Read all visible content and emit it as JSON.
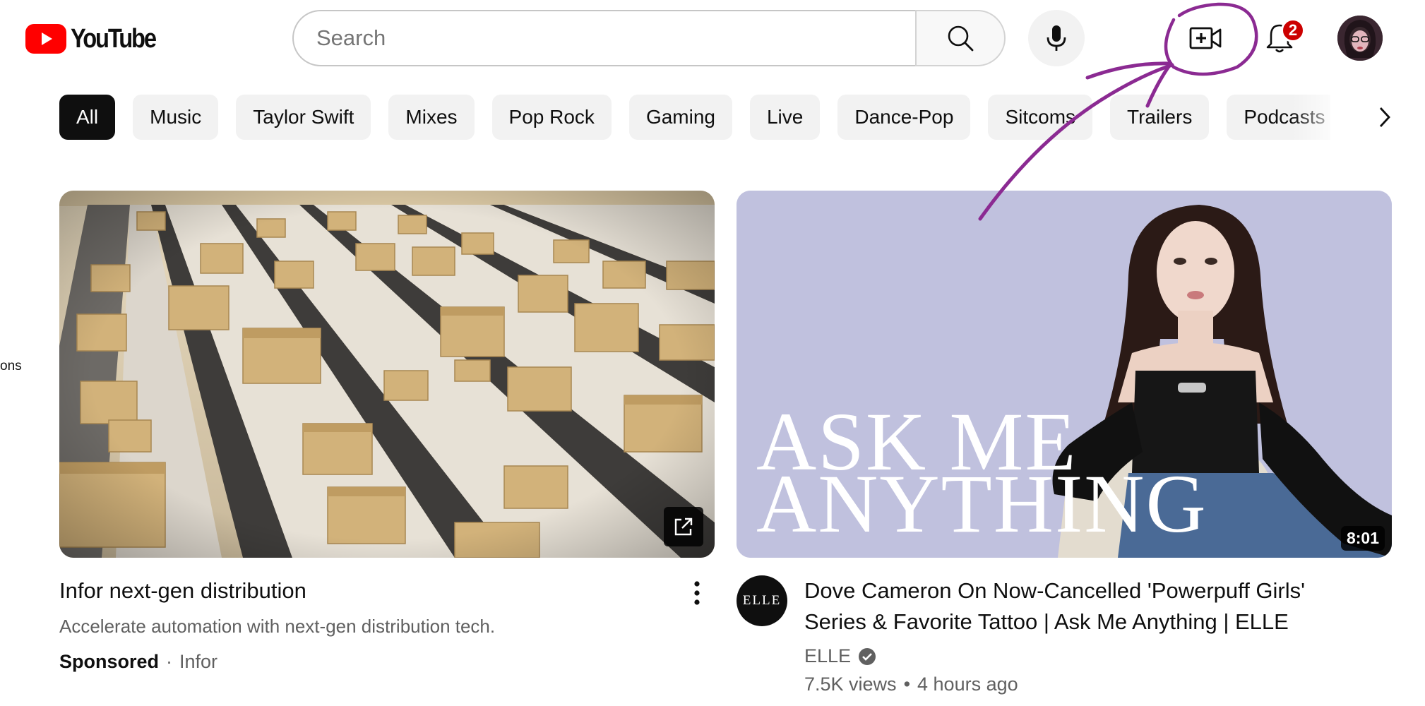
{
  "header": {
    "logo_text": "YouTube",
    "search_placeholder": "Search",
    "notification_count": "2",
    "icons": [
      "youtube-logo-icon",
      "search-icon",
      "microphone-icon",
      "create-video-icon",
      "bell-icon"
    ]
  },
  "chips": [
    {
      "label": "All",
      "active": true
    },
    {
      "label": "Music"
    },
    {
      "label": "Taylor Swift"
    },
    {
      "label": "Mixes"
    },
    {
      "label": "Pop Rock"
    },
    {
      "label": "Gaming"
    },
    {
      "label": "Live"
    },
    {
      "label": "Dance-Pop"
    },
    {
      "label": "Sitcoms"
    },
    {
      "label": "Trailers"
    },
    {
      "label": "Podcasts"
    }
  ],
  "side_clip": "ons",
  "videos": [
    {
      "title": "Infor next-gen distribution",
      "description": "Accelerate automation with next-gen distribution tech.",
      "sponsored_label": "Sponsored",
      "separator": "·",
      "advertiser": "Infor"
    },
    {
      "title_line1": "Dove Cameron On Now-Cancelled 'Powerpuff Girls'",
      "title_line2": "Series & Favorite Tattoo | Ask Me Anything | ELLE",
      "thumb_text_line1": "ASK ME",
      "thumb_text_line2": "ANYTHING",
      "duration": "8:01",
      "channel_avatar_text": "ELLE",
      "channel": "ELLE",
      "views": "7.5K views",
      "separator": "•",
      "age": "4 hours ago"
    }
  ],
  "colors": {
    "brand_red": "#ff0000",
    "annotation_purple": "#8b2a92",
    "active_chip": "#0f0f0f",
    "chip_bg": "#f2f2f2",
    "thumb2_bg": "#c0c1de"
  }
}
